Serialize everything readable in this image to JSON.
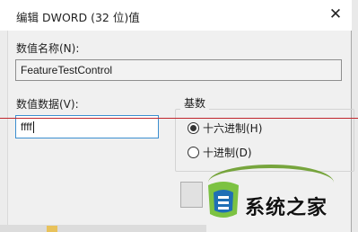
{
  "dialog": {
    "title": "编辑 DWORD (32 位)值",
    "close_glyph": "✕"
  },
  "value_name": {
    "label": "数值名称(N):",
    "value": "FeatureTestControl"
  },
  "value_data": {
    "label": "数值数据(V):",
    "value": "ffff"
  },
  "base": {
    "title": "基数",
    "options": [
      {
        "label": "十六进制(H)",
        "selected": true
      },
      {
        "label": "十进制(D)",
        "selected": false
      }
    ]
  },
  "watermark": {
    "text": "系统之家",
    "colors": {
      "arc": "#6a9d2a",
      "logo_green": "#7cc242",
      "logo_blue": "#1f6fb5"
    }
  },
  "colors": {
    "annotation_line": "#c0262c",
    "focus_border": "#3c8fd0"
  }
}
